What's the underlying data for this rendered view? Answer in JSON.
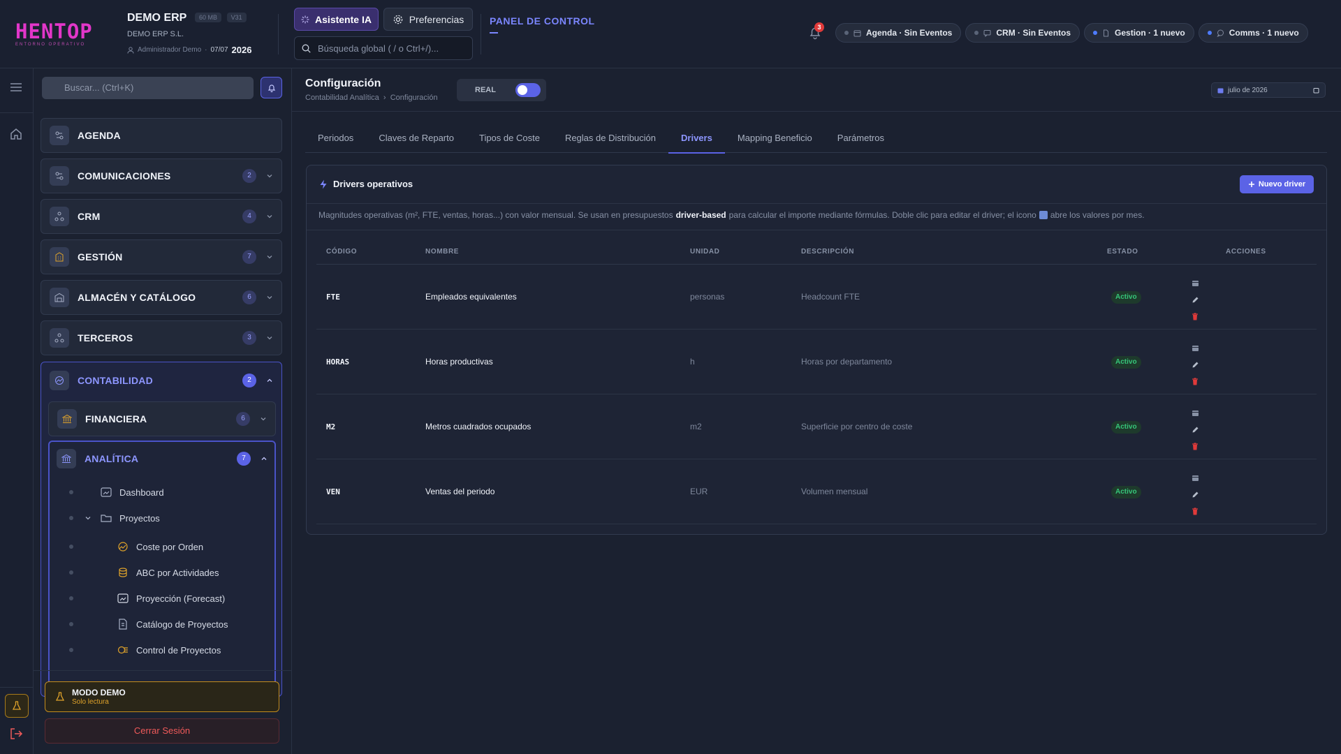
{
  "header": {
    "logo": "HENTOP",
    "logo_sub": "ENTORNO OPERATIVO",
    "company": "DEMO ERP",
    "size_badge": "60 MB",
    "version_badge": "V31",
    "legal_name": "DEMO ERP S.L.",
    "user": "Administrador Demo",
    "date_day": "07/07",
    "date_year": "2026",
    "ai_button": "Asistente IA",
    "prefs_button": "Preferencias",
    "search_placeholder": "Búsqueda global ( / o Ctrl+/)...",
    "panel_title": "PANEL DE CONTROL",
    "bell_count": "3",
    "pills": [
      {
        "label": "Agenda · Sin Eventos",
        "icon": "calendar-icon"
      },
      {
        "label": "CRM · Sin Eventos",
        "icon": "chat-icon"
      },
      {
        "label": "Gestion · 1 nuevo",
        "icon": "document-icon"
      },
      {
        "label": "Comms · 1 nuevo",
        "icon": "message-icon"
      }
    ]
  },
  "sidebar": {
    "search_placeholder": "Buscar... (Ctrl+K)",
    "modules": [
      {
        "label": "AGENDA",
        "count": ""
      },
      {
        "label": "COMUNICACIONES",
        "count": "2"
      },
      {
        "label": "CRM",
        "count": "4"
      },
      {
        "label": "GESTIÓN",
        "count": "7"
      },
      {
        "label": "ALMACÉN Y CATÁLOGO",
        "count": "6"
      },
      {
        "label": "TERCEROS",
        "count": "3"
      }
    ],
    "contabilidad": {
      "label": "CONTABILIDAD",
      "count": "2"
    },
    "financiera": {
      "label": "FINANCIERA",
      "count": "6"
    },
    "analitica": {
      "label": "ANALÍTICA",
      "count": "7",
      "items": [
        {
          "label": "Dashboard"
        },
        {
          "label": "Proyectos"
        },
        {
          "label": "Coste por Orden"
        },
        {
          "label": "ABC por Actividades"
        },
        {
          "label": "Proyección (Forecast)"
        },
        {
          "label": "Catálogo de Proyectos"
        },
        {
          "label": "Control de Proyectos"
        }
      ]
    },
    "demo_title": "MODO DEMO",
    "demo_sub": "Solo lectura",
    "logout": "Cerrar Sesión"
  },
  "main": {
    "title": "Configuración",
    "breadcrumb_1": "Contabilidad Analítica",
    "breadcrumb_2": "Configuración",
    "mode_label": "REAL",
    "period": "julio de 2026",
    "tabs": [
      "Periodos",
      "Claves de Reparto",
      "Tipos de Coste",
      "Reglas de Distribución",
      "Drivers",
      "Mapping Beneficio",
      "Parámetros"
    ],
    "active_tab": "Drivers",
    "card_title": "Drivers operativos",
    "new_button": "Nuevo driver",
    "info_1": "Magnitudes operativas (m², FTE, ventas, horas...) con valor mensual. Se usan en presupuestos",
    "info_bold": "driver-based",
    "info_2": "para calcular el importe mediante fórmulas. Doble clic para editar el driver; el icono",
    "info_3": "abre los valores por mes.",
    "columns": [
      "CÓDIGO",
      "NOMBRE",
      "UNIDAD",
      "DESCRIPCIÓN",
      "ESTADO",
      "ACCIONES"
    ],
    "rows": [
      {
        "code": "FTE",
        "name": "Empleados equivalentes",
        "unit": "personas",
        "desc": "Headcount FTE",
        "status": "Activo"
      },
      {
        "code": "HORAS",
        "name": "Horas productivas",
        "unit": "h",
        "desc": "Horas por departamento",
        "status": "Activo"
      },
      {
        "code": "M2",
        "name": "Metros cuadrados ocupados",
        "unit": "m2",
        "desc": "Superficie por centro de coste",
        "status": "Activo"
      },
      {
        "code": "VEN",
        "name": "Ventas del periodo",
        "unit": "EUR",
        "desc": "Volumen mensual",
        "status": "Activo"
      }
    ]
  },
  "colors": {
    "accent": "#5b63e6",
    "brand": "#e236c9",
    "active_status": "#36c77a",
    "danger": "#e03a3a",
    "warning": "#c58d1c"
  }
}
